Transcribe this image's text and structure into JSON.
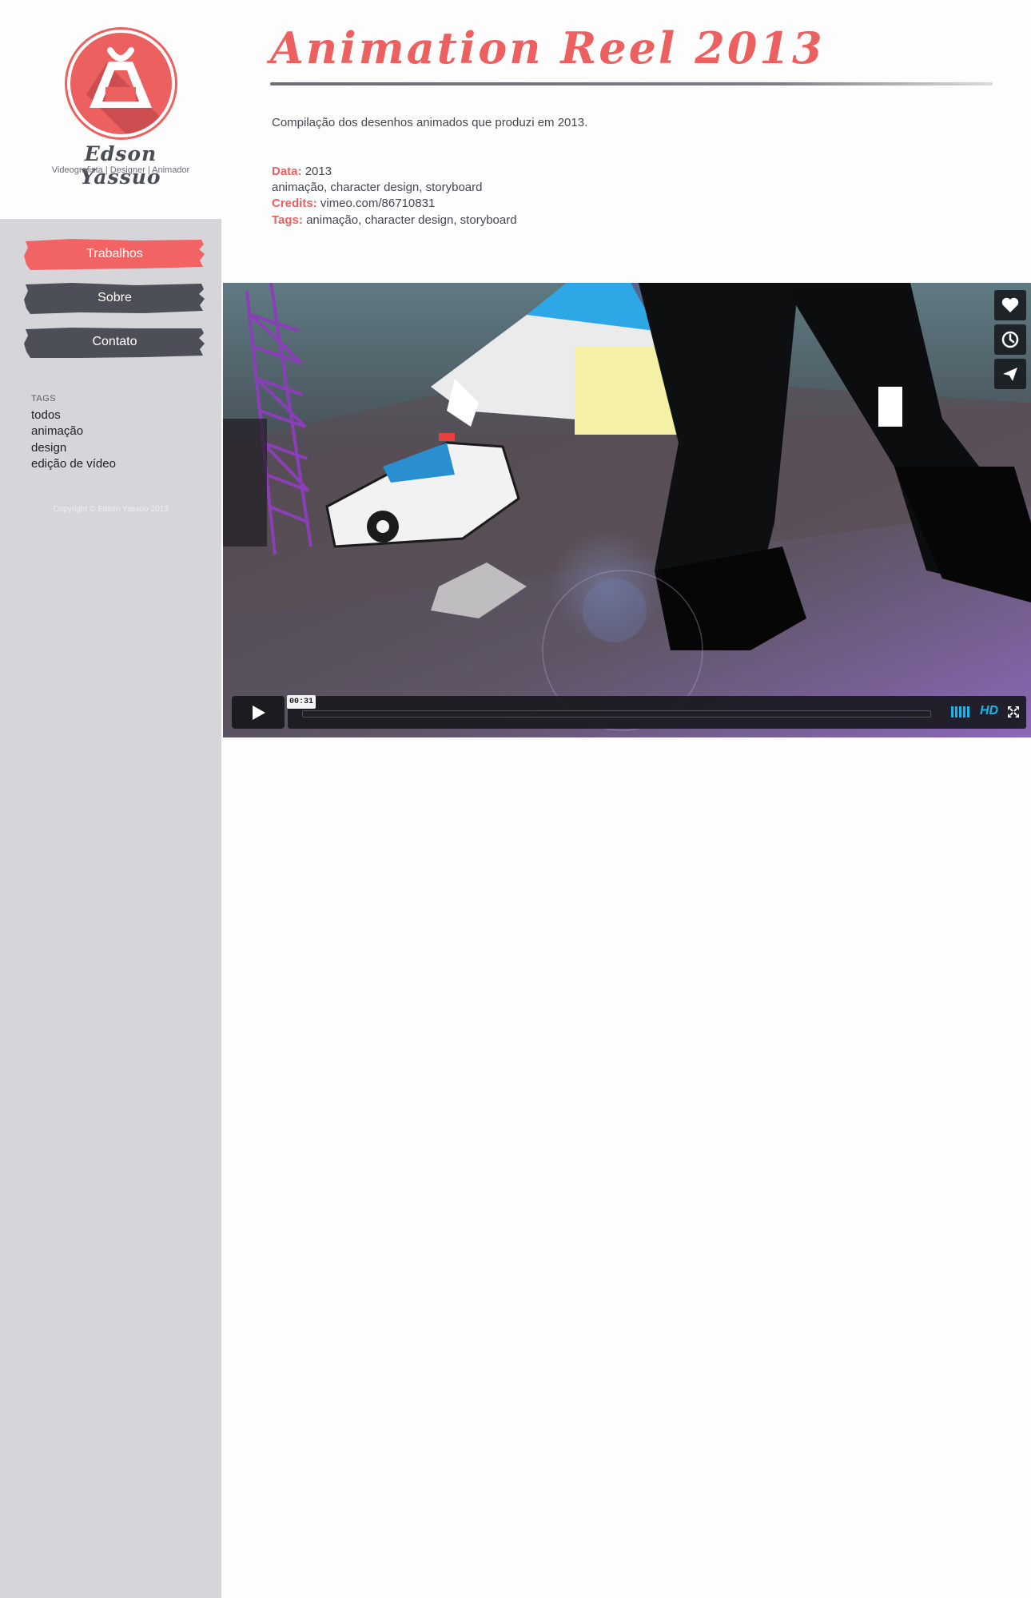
{
  "brand": {
    "name": "Edson Yassuo",
    "subtitle": "Videografista | Designer | Animador"
  },
  "nav": {
    "items": [
      {
        "label": "Trabalhos",
        "active": true
      },
      {
        "label": "Sobre",
        "active": false
      },
      {
        "label": "Contato",
        "active": false
      }
    ]
  },
  "tags": {
    "heading": "TAGS",
    "items": [
      "todos",
      "animação",
      "design",
      "edição de vídeo"
    ]
  },
  "footer": {
    "copyright": "Copyright © Edson Yassuo 2013"
  },
  "project": {
    "title": "Animation Reel 2013",
    "description": "Compilação dos desenhos animados que produzi em 2013.",
    "meta": {
      "data_label": "Data:",
      "data_value": "2013",
      "categories": "animação, character design, storyboard",
      "credits_label": "Credits:",
      "credits_value": "vimeo.com/86710831",
      "tags_label": "Tags:",
      "tags_value": "animação, character design, storyboard"
    }
  },
  "video": {
    "time": "00:31",
    "hd_label": "HD",
    "progress": 0,
    "icons": [
      "heart-icon",
      "clock-icon",
      "paper-plane-icon",
      "play-icon",
      "volume-icon",
      "fullscreen-icon"
    ]
  },
  "colors": {
    "accent": "#ec6060",
    "nav_dark": "#4c4f57",
    "sidebar_bg": "#d5d5da",
    "player_blue": "#19b6e8"
  }
}
